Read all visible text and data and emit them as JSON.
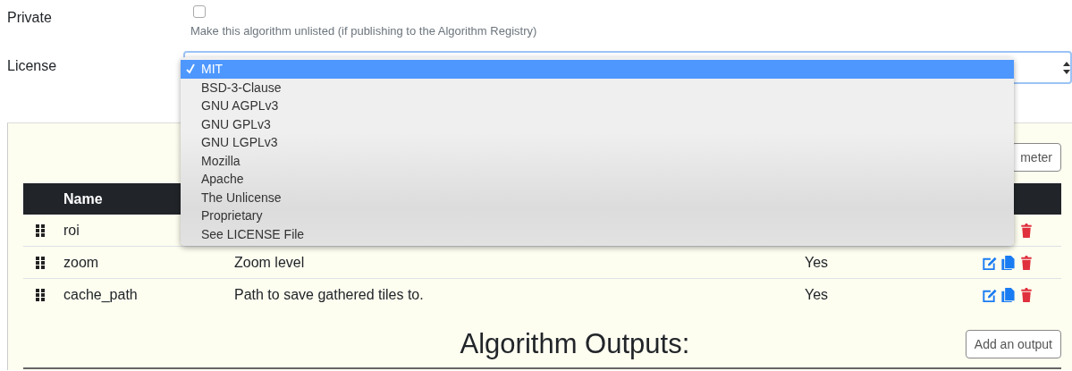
{
  "private": {
    "label": "Private",
    "checked": false,
    "help": "Make this algorithm unlisted (if publishing to the Algorithm Registry)"
  },
  "license": {
    "label": "License",
    "options": [
      {
        "label": "MIT",
        "selected": true
      },
      {
        "label": "BSD-3-Clause",
        "selected": false
      },
      {
        "label": "GNU AGPLv3",
        "selected": false
      },
      {
        "label": "GNU GPLv3",
        "selected": false
      },
      {
        "label": "GNU LGPLv3",
        "selected": false
      },
      {
        "label": "Mozilla",
        "selected": false
      },
      {
        "label": "Apache",
        "selected": false
      },
      {
        "label": "The Unlicense",
        "selected": false
      },
      {
        "label": "Proprietary",
        "selected": false
      },
      {
        "label": "See LICENSE File",
        "selected": false
      }
    ]
  },
  "parameters": {
    "add_button": "meter",
    "columns": [
      "Name"
    ],
    "rows": [
      {
        "name": "roi",
        "actions": [
          {
            "kind": "delete"
          }
        ]
      },
      {
        "name": "zoom",
        "description": "Zoom level",
        "required": "Yes",
        "actions": [
          {
            "kind": "edit"
          },
          {
            "kind": "copy"
          },
          {
            "kind": "delete"
          }
        ]
      },
      {
        "name": "cache_path",
        "description": "Path to save gathered tiles to.",
        "required": "Yes",
        "actions": [
          {
            "kind": "edit"
          },
          {
            "kind": "copy"
          },
          {
            "kind": "delete"
          }
        ]
      }
    ]
  },
  "outputs": {
    "title": "Algorithm Outputs:",
    "add_button": "Add an output"
  }
}
